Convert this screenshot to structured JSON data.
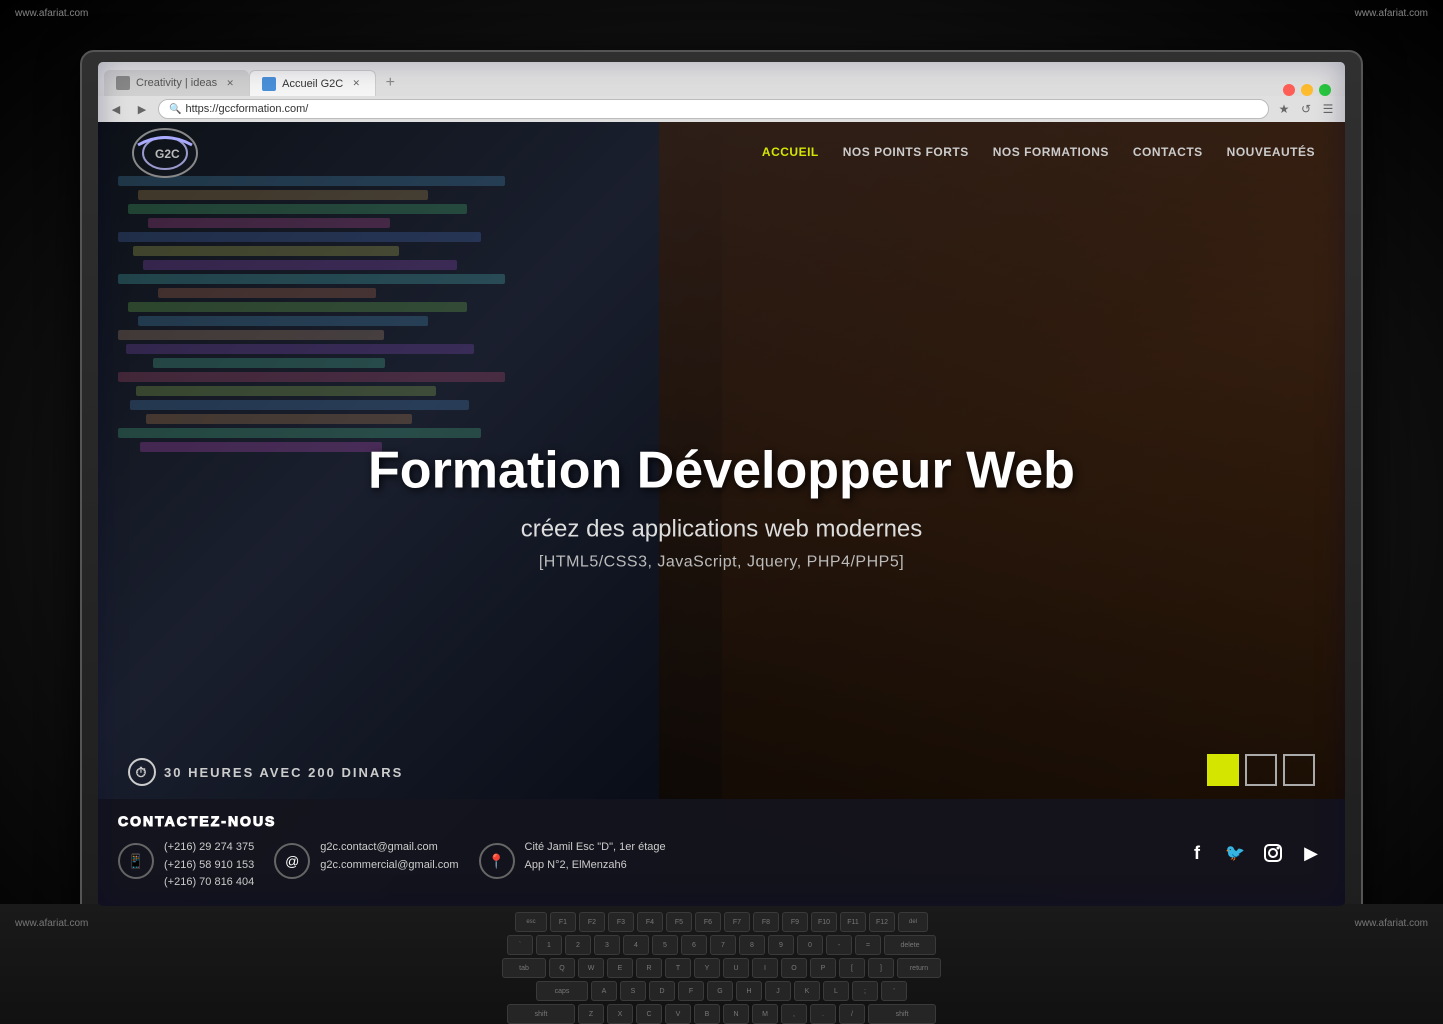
{
  "watermarks": {
    "top_left": "www.afariat.com",
    "top_right": "www.afariat.com",
    "bottom_left": "www.afariat.com",
    "bottom_right": "www.afariat.com"
  },
  "browser": {
    "tabs": [
      {
        "label": "Creativity | ideas",
        "active": false,
        "url": ""
      },
      {
        "label": "Accueil G2C",
        "active": true,
        "url": "https://gccformation.com/"
      }
    ],
    "address": "https://gccformation.com/",
    "toolbar_icons": [
      "★",
      "↺",
      "☰"
    ]
  },
  "nav": {
    "logo_text": "G2C",
    "links": [
      {
        "label": "ACCUEIL",
        "active": true
      },
      {
        "label": "NOS POINTS FORTS",
        "active": false
      },
      {
        "label": "NOS FORMATIONS",
        "active": false
      },
      {
        "label": "CONTACTS",
        "active": false
      },
      {
        "label": "NOUVEAUTÉS",
        "active": false
      }
    ]
  },
  "hero": {
    "title": "Formation Développeur Web",
    "subtitle": "créez des applications web modernes",
    "tech_stack": "[HTML5/CSS3, JavaScript, Jquery, PHP4/PHP5]",
    "duration": "30 HEURES AVEC 200 DINARS"
  },
  "contact_section": {
    "title": "CONTACTEZ-NOUS",
    "phones": [
      "(+216)  29 274 375",
      "(+216)  58 910 153",
      "(+216)  70 816 404"
    ],
    "emails": [
      "g2c.contact@gmail.com",
      "g2c.commercial@gmail.com"
    ],
    "address_line1": "Cité Jamil Esc \"D\", 1er étage",
    "address_line2": "App N°2, ElMenzah6"
  },
  "social": {
    "icons": [
      "f",
      "🐦",
      "📷",
      "▶"
    ]
  },
  "slider": {
    "active_index": 0,
    "total": 3
  }
}
